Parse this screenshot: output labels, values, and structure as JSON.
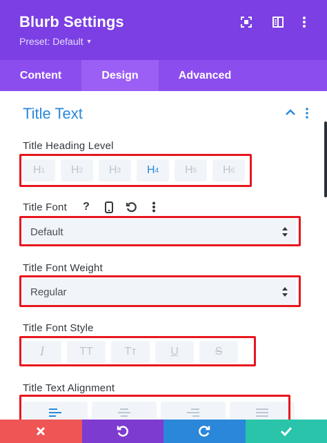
{
  "header": {
    "title": "Blurb Settings",
    "preset": "Preset: Default"
  },
  "tabs": [
    {
      "label": "Content",
      "active": false
    },
    {
      "label": "Design",
      "active": true
    },
    {
      "label": "Advanced",
      "active": false
    }
  ],
  "section": {
    "title": "Title Text"
  },
  "heading_level": {
    "label": "Title Heading Level",
    "options": [
      {
        "main": "H",
        "sub": "1"
      },
      {
        "main": "H",
        "sub": "2"
      },
      {
        "main": "H",
        "sub": "3"
      },
      {
        "main": "H",
        "sub": "4"
      },
      {
        "main": "H",
        "sub": "5"
      },
      {
        "main": "H",
        "sub": "6"
      }
    ],
    "selected": "H4"
  },
  "font": {
    "label": "Title Font",
    "help_glyph": "?",
    "value": "Default"
  },
  "font_weight": {
    "label": "Title Font Weight",
    "value": "Regular"
  },
  "font_style": {
    "label": "Title Font Style",
    "options": [
      "I",
      "TT",
      "Tт",
      "U",
      "S"
    ]
  },
  "alignment": {
    "label": "Title Text Alignment"
  },
  "colors": {
    "header": "#7b3fe4",
    "tabs": "#8c4dee",
    "active_tab": "#9b5ff5",
    "accent": "#2b87da",
    "highlight": "#e8151d",
    "cancel": "#ef5555",
    "undo": "#7e3bd0",
    "redo": "#2b87da",
    "save": "#29c4a9"
  }
}
